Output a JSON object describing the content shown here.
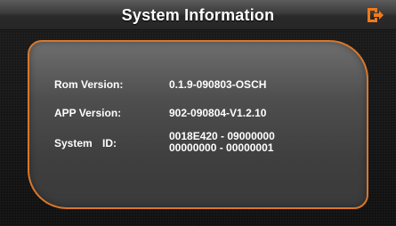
{
  "header": {
    "title": "System Information",
    "exit_icon": "exit-icon",
    "accent_color": "#f07a1a"
  },
  "info": {
    "rom_label": "Rom Version:",
    "rom_value": "0.1.9-090803-OSCH",
    "app_label": "APP Version:",
    "app_value": "902-090804-V1.2.10",
    "system_label": "System ID:",
    "system_value_line1": "0018E420 - 09000000",
    "system_value_line2": "00000000 - 00000001"
  }
}
